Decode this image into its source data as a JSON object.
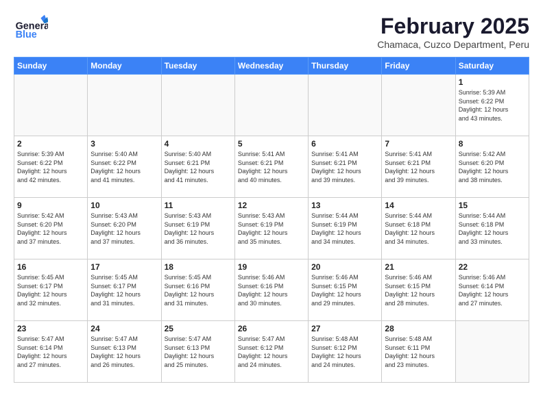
{
  "header": {
    "logo_general": "General",
    "logo_blue": "Blue",
    "title": "February 2025",
    "subtitle": "Chamaca, Cuzco Department, Peru"
  },
  "weekdays": [
    "Sunday",
    "Monday",
    "Tuesday",
    "Wednesday",
    "Thursday",
    "Friday",
    "Saturday"
  ],
  "weeks": [
    [
      {
        "day": "",
        "info": ""
      },
      {
        "day": "",
        "info": ""
      },
      {
        "day": "",
        "info": ""
      },
      {
        "day": "",
        "info": ""
      },
      {
        "day": "",
        "info": ""
      },
      {
        "day": "",
        "info": ""
      },
      {
        "day": "1",
        "info": "Sunrise: 5:39 AM\nSunset: 6:22 PM\nDaylight: 12 hours\nand 43 minutes."
      }
    ],
    [
      {
        "day": "2",
        "info": "Sunrise: 5:39 AM\nSunset: 6:22 PM\nDaylight: 12 hours\nand 42 minutes."
      },
      {
        "day": "3",
        "info": "Sunrise: 5:40 AM\nSunset: 6:22 PM\nDaylight: 12 hours\nand 41 minutes."
      },
      {
        "day": "4",
        "info": "Sunrise: 5:40 AM\nSunset: 6:21 PM\nDaylight: 12 hours\nand 41 minutes."
      },
      {
        "day": "5",
        "info": "Sunrise: 5:41 AM\nSunset: 6:21 PM\nDaylight: 12 hours\nand 40 minutes."
      },
      {
        "day": "6",
        "info": "Sunrise: 5:41 AM\nSunset: 6:21 PM\nDaylight: 12 hours\nand 39 minutes."
      },
      {
        "day": "7",
        "info": "Sunrise: 5:41 AM\nSunset: 6:21 PM\nDaylight: 12 hours\nand 39 minutes."
      },
      {
        "day": "8",
        "info": "Sunrise: 5:42 AM\nSunset: 6:20 PM\nDaylight: 12 hours\nand 38 minutes."
      }
    ],
    [
      {
        "day": "9",
        "info": "Sunrise: 5:42 AM\nSunset: 6:20 PM\nDaylight: 12 hours\nand 37 minutes."
      },
      {
        "day": "10",
        "info": "Sunrise: 5:43 AM\nSunset: 6:20 PM\nDaylight: 12 hours\nand 37 minutes."
      },
      {
        "day": "11",
        "info": "Sunrise: 5:43 AM\nSunset: 6:19 PM\nDaylight: 12 hours\nand 36 minutes."
      },
      {
        "day": "12",
        "info": "Sunrise: 5:43 AM\nSunset: 6:19 PM\nDaylight: 12 hours\nand 35 minutes."
      },
      {
        "day": "13",
        "info": "Sunrise: 5:44 AM\nSunset: 6:19 PM\nDaylight: 12 hours\nand 34 minutes."
      },
      {
        "day": "14",
        "info": "Sunrise: 5:44 AM\nSunset: 6:18 PM\nDaylight: 12 hours\nand 34 minutes."
      },
      {
        "day": "15",
        "info": "Sunrise: 5:44 AM\nSunset: 6:18 PM\nDaylight: 12 hours\nand 33 minutes."
      }
    ],
    [
      {
        "day": "16",
        "info": "Sunrise: 5:45 AM\nSunset: 6:17 PM\nDaylight: 12 hours\nand 32 minutes."
      },
      {
        "day": "17",
        "info": "Sunrise: 5:45 AM\nSunset: 6:17 PM\nDaylight: 12 hours\nand 31 minutes."
      },
      {
        "day": "18",
        "info": "Sunrise: 5:45 AM\nSunset: 6:16 PM\nDaylight: 12 hours\nand 31 minutes."
      },
      {
        "day": "19",
        "info": "Sunrise: 5:46 AM\nSunset: 6:16 PM\nDaylight: 12 hours\nand 30 minutes."
      },
      {
        "day": "20",
        "info": "Sunrise: 5:46 AM\nSunset: 6:15 PM\nDaylight: 12 hours\nand 29 minutes."
      },
      {
        "day": "21",
        "info": "Sunrise: 5:46 AM\nSunset: 6:15 PM\nDaylight: 12 hours\nand 28 minutes."
      },
      {
        "day": "22",
        "info": "Sunrise: 5:46 AM\nSunset: 6:14 PM\nDaylight: 12 hours\nand 27 minutes."
      }
    ],
    [
      {
        "day": "23",
        "info": "Sunrise: 5:47 AM\nSunset: 6:14 PM\nDaylight: 12 hours\nand 27 minutes."
      },
      {
        "day": "24",
        "info": "Sunrise: 5:47 AM\nSunset: 6:13 PM\nDaylight: 12 hours\nand 26 minutes."
      },
      {
        "day": "25",
        "info": "Sunrise: 5:47 AM\nSunset: 6:13 PM\nDaylight: 12 hours\nand 25 minutes."
      },
      {
        "day": "26",
        "info": "Sunrise: 5:47 AM\nSunset: 6:12 PM\nDaylight: 12 hours\nand 24 minutes."
      },
      {
        "day": "27",
        "info": "Sunrise: 5:48 AM\nSunset: 6:12 PM\nDaylight: 12 hours\nand 24 minutes."
      },
      {
        "day": "28",
        "info": "Sunrise: 5:48 AM\nSunset: 6:11 PM\nDaylight: 12 hours\nand 23 minutes."
      },
      {
        "day": "",
        "info": ""
      }
    ]
  ]
}
